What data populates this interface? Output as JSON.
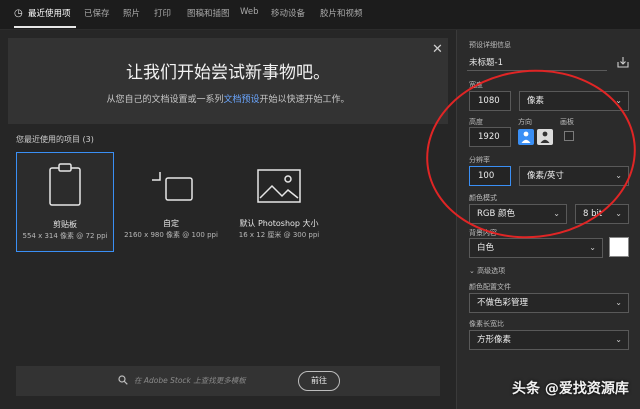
{
  "nav": {
    "tabs": [
      "最近使用项",
      "已保存",
      "照片",
      "打印",
      "图稿和插图",
      "Web",
      "移动设备",
      "胶片和视频"
    ]
  },
  "hero": {
    "title": "让我们开始尝试新事物吧。",
    "subtitle_pre": "从您自己的文档设置或一系列",
    "subtitle_link": "文档预设",
    "subtitle_post": "开始以快速开始工作。"
  },
  "recent": {
    "title": "您最近使用的项目 (3)",
    "items": [
      {
        "name": "剪贴板",
        "meta": "554 x 314 像素 @ 72 ppi",
        "icon": "clipboard-icon"
      },
      {
        "name": "自定",
        "meta": "2160 x 980 像素 @ 100 ppi",
        "icon": "custom-crop-icon"
      },
      {
        "name": "默认 Photoshop 大小",
        "meta": "16 x 12 厘米 @ 300 ppi",
        "icon": "image-icon"
      }
    ]
  },
  "search": {
    "placeholder": "在 Adobe Stock 上查找更多模板",
    "go": "前往"
  },
  "preset": {
    "header": "预设详细信息",
    "doc_name": "未标题-1",
    "width_label": "宽度",
    "width_value": "1080",
    "width_unit": "像素",
    "height_label": "高度",
    "height_value": "1920",
    "orientation_label": "方向",
    "artboard_label": "画板",
    "resolution_label": "分辨率",
    "resolution_value": "100",
    "resolution_unit": "像素/英寸",
    "color_mode_label": "颜色模式",
    "color_mode": "RGB 颜色",
    "bit_depth": "8 bit",
    "background_label": "背景内容",
    "background": "白色",
    "advanced_label": "高级选项",
    "color_profile_label": "颜色配置文件",
    "color_profile": "不做色彩管理",
    "pixel_aspect_label": "像素长宽比",
    "pixel_aspect": "方形像素"
  },
  "watermark": "头条 @爱找资源库",
  "colors": {
    "accent": "#3a8ff5",
    "annotation": "#e02525"
  }
}
